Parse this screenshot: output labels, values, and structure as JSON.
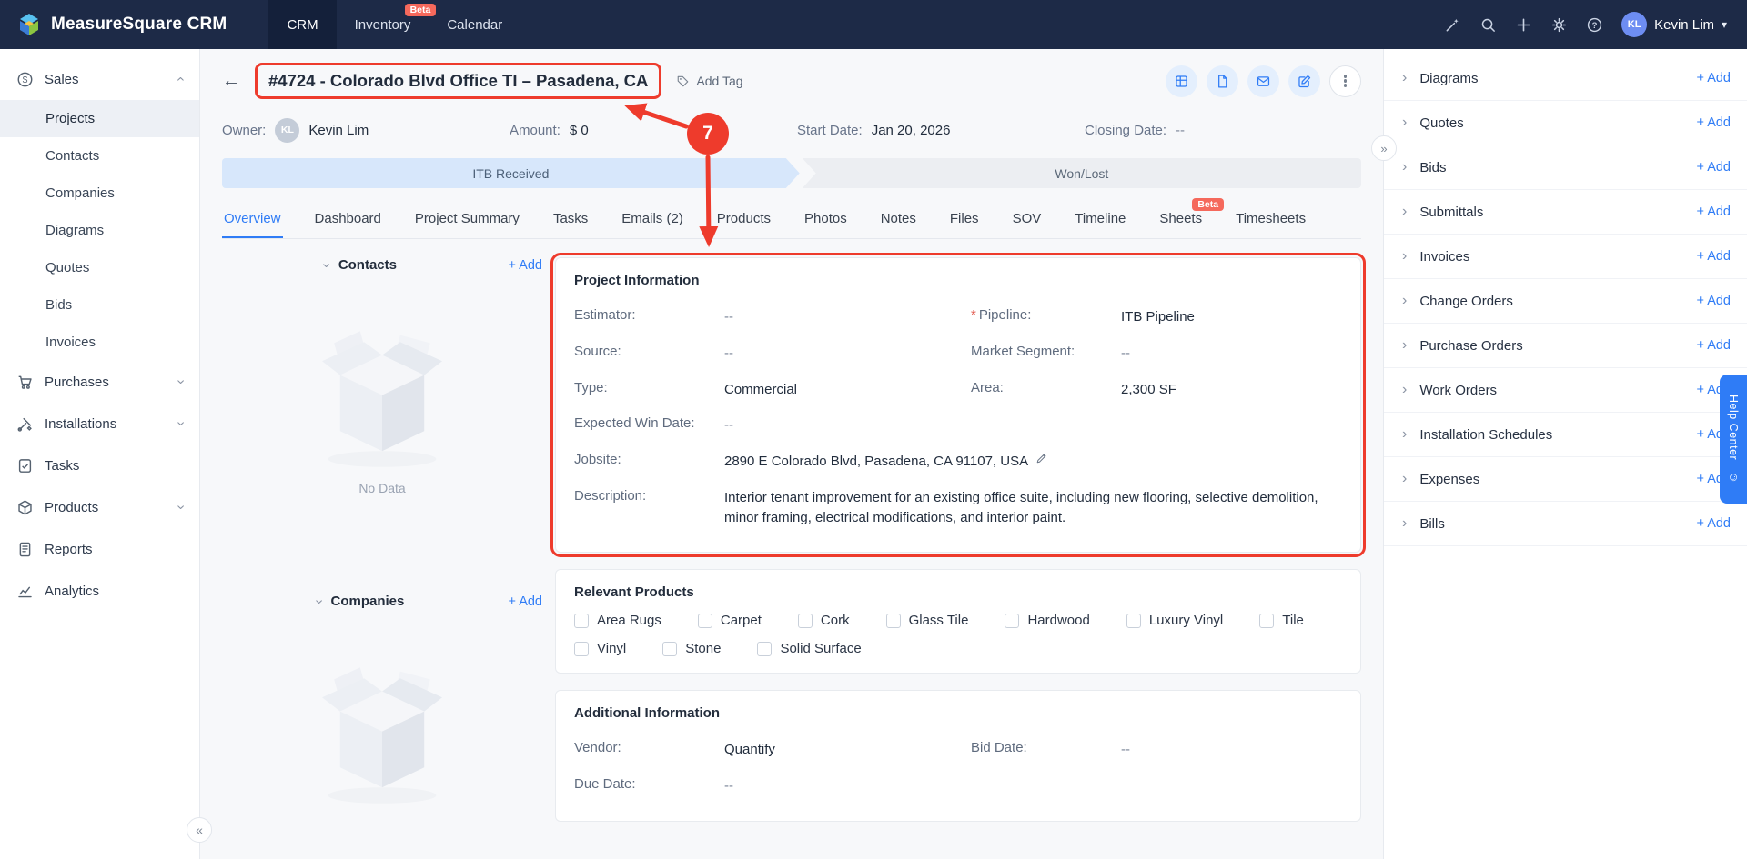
{
  "colors": {
    "accent": "#2f7cf6",
    "annotation_red": "#ee3b2c",
    "beta_badge": "#f5695c",
    "topbar_bg": "#1d2a47"
  },
  "icons": {
    "back": "←",
    "collapse": "«",
    "expand": "»",
    "caret_down": "▾",
    "chevron": "›",
    "help_face": "☺"
  },
  "topbar": {
    "brand": "MeasureSquare CRM",
    "nav": [
      {
        "label": "CRM"
      },
      {
        "label": "Inventory",
        "badge": "Beta"
      },
      {
        "label": "Calendar"
      }
    ],
    "user": {
      "name": "Kevin Lim",
      "initials": "KL"
    }
  },
  "sidebar": {
    "sales": {
      "label": "Sales"
    },
    "sales_items": [
      {
        "label": "Projects"
      },
      {
        "label": "Contacts"
      },
      {
        "label": "Companies"
      },
      {
        "label": "Diagrams"
      },
      {
        "label": "Quotes"
      },
      {
        "label": "Bids"
      },
      {
        "label": "Invoices"
      }
    ],
    "items": [
      {
        "label": "Purchases"
      },
      {
        "label": "Installations"
      },
      {
        "label": "Tasks"
      },
      {
        "label": "Products"
      },
      {
        "label": "Reports"
      },
      {
        "label": "Analytics"
      }
    ]
  },
  "header": {
    "title": "#4724 - Colorado Blvd Office TI – Pasadena, CA",
    "add_tag": "Add Tag"
  },
  "summary": {
    "owner_label": "Owner:",
    "owner_name": "Kevin Lim",
    "owner_initials": "KL",
    "amount_label": "Amount:",
    "amount_value": "$ 0",
    "start_label": "Start Date:",
    "start_value": "Jan 20, 2026",
    "closing_label": "Closing Date:",
    "closing_value": "--"
  },
  "pipeline_bar": {
    "stages": [
      {
        "label": "ITB Received"
      },
      {
        "label": "Won/Lost"
      }
    ]
  },
  "tabs": {
    "items": [
      {
        "label": "Overview"
      },
      {
        "label": "Dashboard"
      },
      {
        "label": "Project Summary"
      },
      {
        "label": "Tasks"
      },
      {
        "label": "Emails (2)"
      },
      {
        "label": "Products"
      },
      {
        "label": "Photos"
      },
      {
        "label": "Notes"
      },
      {
        "label": "Files"
      },
      {
        "label": "SOV"
      },
      {
        "label": "Timeline"
      },
      {
        "label": "Sheets",
        "badge": "Beta"
      },
      {
        "label": "Timesheets"
      }
    ]
  },
  "contacts_panel": {
    "title": "Contacts",
    "add": "+ Add",
    "empty": "No Data"
  },
  "companies_panel": {
    "title": "Companies",
    "add": "+ Add"
  },
  "project_info": {
    "title": "Project Information",
    "estimator_label": "Estimator:",
    "estimator": "--",
    "pipeline_label": "Pipeline:",
    "pipeline": "ITB Pipeline",
    "required_mark": "*",
    "source_label": "Source:",
    "source": "--",
    "market_label": "Market Segment:",
    "market": "--",
    "type_label": "Type:",
    "type": "Commercial",
    "area_label": "Area:",
    "area": "2,300 SF",
    "expected_win_label": "Expected Win Date:",
    "expected_win": "--",
    "jobsite_label": "Jobsite:",
    "jobsite": "2890 E Colorado Blvd, Pasadena, CA 91107, USA",
    "description_label": "Description:",
    "description": "Interior tenant improvement for an existing office suite, including new flooring, selective demolition, minor framing, electrical modifications, and interior paint."
  },
  "relevant_products": {
    "title": "Relevant Products",
    "options": [
      "Area Rugs",
      "Carpet",
      "Cork",
      "Glass Tile",
      "Hardwood",
      "Luxury Vinyl",
      "Tile",
      "Vinyl",
      "Stone",
      "Solid Surface"
    ]
  },
  "additional_info": {
    "title": "Additional Information",
    "vendor_label": "Vendor:",
    "vendor": "Quantify",
    "bid_label": "Bid Date:",
    "bid": "--",
    "due_label": "Due Date:",
    "due": "--"
  },
  "right_panel": {
    "add_label": "+ Add",
    "sections": [
      "Diagrams",
      "Quotes",
      "Bids",
      "Submittals",
      "Invoices",
      "Change Orders",
      "Purchase Orders",
      "Work Orders",
      "Installation Schedules",
      "Expenses",
      "Bills"
    ]
  },
  "help_center": {
    "label": "Help Center"
  },
  "annotation": {
    "number": "7"
  }
}
